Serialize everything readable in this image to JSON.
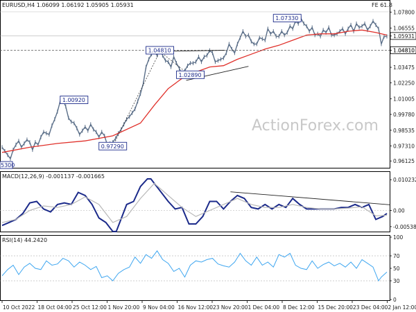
{
  "header": {
    "symbol_line": "EURUSD,H4  1.06099 1.06192 1.05905 1.05931",
    "fe_label": "FE 61.8",
    "watermark": "ActionForex.com"
  },
  "colors": {
    "candles": "#5a6e88",
    "ma": "#e0302a",
    "macd": "#1b2a8a",
    "signal": "#b8b8b8",
    "rsi": "#3ea6f0",
    "trend": "#222222",
    "label_border": "#1b2a8a",
    "grid_dash": "#555555"
  },
  "chart_data": [
    {
      "type": "line",
      "name": "price",
      "title": "EURUSD,H4  1.06099 1.06192 1.05905 1.05931",
      "ylim": [
        0.957,
        1.081
      ],
      "y_ticks": [
        "1.07800",
        "1.06555",
        "1.05931",
        "1.04810",
        "1.03475",
        "1.02250",
        "1.01005",
        "0.99780",
        "0.98535",
        "0.97310",
        "0.96125"
      ],
      "x_ticks": [
        "10 Oct 2022",
        "18 Oct 04:00",
        "25 Oct 12:00",
        "1 Nov 20:00",
        "9 Nov 04:00",
        "16 Nov 12:00",
        "23 Nov 20:00",
        "1 Dec 04:00",
        "8 Dec 12:00",
        "15 Dec 20:00",
        "23 Dec 04:00",
        "2 Jan 12:00"
      ],
      "current_price": "1.05931",
      "series": [
        {
          "name": "EURUSD",
          "x": [
            0,
            4,
            8,
            12,
            16,
            20,
            24,
            28,
            32,
            36,
            40,
            44,
            48,
            52,
            56,
            60,
            64,
            68,
            72,
            76,
            80,
            84,
            88,
            92,
            96,
            100,
            104,
            108,
            112,
            116,
            120,
            124,
            128,
            132,
            136,
            140,
            144,
            148,
            152,
            156,
            160,
            164,
            168,
            172,
            176,
            180,
            184,
            188,
            192,
            196,
            200,
            204,
            208,
            212,
            216,
            220,
            224,
            228,
            232,
            236,
            240,
            244,
            248,
            252,
            256,
            260,
            264,
            268,
            272,
            276,
            280,
            284,
            288,
            292,
            296,
            300,
            304,
            308,
            312,
            316,
            320,
            324,
            328,
            332,
            336,
            340,
            344,
            348,
            352,
            356,
            360,
            364,
            368,
            372,
            376,
            380,
            384,
            388,
            392,
            396,
            400,
            404,
            408,
            412,
            416,
            420,
            424,
            428,
            432,
            436,
            440,
            444,
            448,
            452,
            456,
            460,
            464,
            468,
            472,
            476,
            480,
            484,
            488,
            492,
            496,
            500,
            504,
            508,
            512,
            516,
            520,
            524,
            528,
            532,
            536,
            540,
            544,
            548,
            552,
            556
          ],
          "values": [
            0.972,
            0.969,
            0.966,
            0.963,
            0.97,
            0.974,
            0.977,
            0.972,
            0.975,
            0.978,
            0.976,
            0.97,
            0.976,
            0.974,
            0.98,
            0.984,
            0.983,
            0.982,
            0.989,
            0.994,
            1.0,
            1.008,
            1.009,
            1.004,
            0.995,
            0.992,
            0.991,
            0.987,
            0.982,
            0.985,
            0.988,
            0.985,
            0.99,
            0.986,
            0.984,
            0.98,
            0.984,
            0.981,
            0.974,
            0.975,
            0.976,
            0.979,
            0.983,
            0.986,
            0.99,
            0.994,
            0.996,
            0.999,
            1.002,
            1.008,
            1.014,
            1.022,
            1.035,
            1.041,
            1.045,
            1.047,
            1.044,
            1.049,
            1.044,
            1.04,
            1.039,
            1.035,
            1.043,
            1.038,
            1.034,
            1.029,
            1.032,
            1.036,
            1.038,
            1.038,
            1.039,
            1.043,
            1.039,
            1.043,
            1.044,
            1.048,
            1.046,
            1.039,
            1.04,
            1.041,
            1.042,
            1.046,
            1.053,
            1.049,
            1.046,
            1.053,
            1.058,
            1.063,
            1.059,
            1.06,
            1.055,
            1.053,
            1.053,
            1.058,
            1.057,
            1.056,
            1.065,
            1.061,
            1.063,
            1.059,
            1.059,
            1.063,
            1.06,
            1.062,
            1.067,
            1.065,
            1.071,
            1.069,
            1.073,
            1.069,
            1.067,
            1.063,
            1.066,
            1.06,
            1.061,
            1.059,
            1.064,
            1.062,
            1.066,
            1.06,
            1.06,
            1.061,
            1.063,
            1.065,
            1.061,
            1.065,
            1.068,
            1.063,
            1.069,
            1.066,
            1.067,
            1.069,
            1.064,
            1.067,
            1.071,
            1.068,
            1.065,
            1.053,
            1.059,
            1.059
          ]
        },
        {
          "name": "MA",
          "x": [
            0,
            40,
            80,
            120,
            160,
            200,
            220,
            240,
            260,
            280,
            300,
            320,
            340,
            360,
            380,
            400,
            420,
            440,
            460,
            480,
            500,
            520,
            540,
            556
          ],
          "values": [
            0.968,
            0.972,
            0.975,
            0.977,
            0.981,
            0.991,
            1.005,
            1.018,
            1.026,
            1.031,
            1.035,
            1.036,
            1.041,
            1.045,
            1.049,
            1.052,
            1.056,
            1.06,
            1.061,
            1.061,
            1.063,
            1.064,
            1.062,
            1.06
          ]
        }
      ],
      "annotations": [
        {
          "text": "1.00920",
          "x": 104,
          "y": 1.0092
        },
        {
          "text": "0.97290",
          "x": 160,
          "y": 0.9729
        },
        {
          "text": "1.04810",
          "x": 228,
          "y": 1.0481
        },
        {
          "text": "1.02890",
          "x": 272,
          "y": 1.0289
        },
        {
          "text": "1.07330",
          "x": 412,
          "y": 1.0733
        },
        {
          "text": "1.04810",
          "axis": true,
          "y": 1.0481
        }
      ]
    },
    {
      "type": "line",
      "name": "macd",
      "title": "MACD(12,26,9) -0.001137 -0.001665",
      "ylim": [
        -0.0068,
        0.0112
      ],
      "y_ticks": [
        "0.010232",
        "0.00",
        "-0.005389"
      ],
      "series": [
        {
          "name": "MACD",
          "x": [
            0,
            10,
            20,
            30,
            40,
            50,
            60,
            70,
            80,
            90,
            100,
            110,
            120,
            130,
            140,
            150,
            160,
            165,
            170,
            180,
            190,
            200,
            210,
            215,
            220,
            230,
            240,
            250,
            260,
            270,
            280,
            290,
            300,
            310,
            320,
            330,
            340,
            350,
            360,
            370,
            380,
            390,
            400,
            410,
            420,
            430,
            440,
            450,
            460,
            470,
            480,
            490,
            500,
            510,
            520,
            530,
            540,
            550,
            556
          ],
          "values": [
            -0.005,
            -0.004,
            -0.003,
            -0.001,
            0.0025,
            0.003,
            0.0005,
            -0.0005,
            0.002,
            0.0025,
            0.002,
            0.006,
            0.005,
            0.002,
            -0.0025,
            -0.004,
            -0.007,
            -0.007,
            -0.004,
            0.002,
            0.003,
            0.008,
            0.0105,
            0.0105,
            0.009,
            0.006,
            0.003,
            0.0005,
            0.001,
            -0.0045,
            -0.0045,
            -0.002,
            0.003,
            0.003,
            0.0005,
            0.003,
            0.005,
            0.004,
            0.001,
            0.0005,
            0.002,
            0.0005,
            0.002,
            0.001,
            0.004,
            0.002,
            0.0005,
            0.0005,
            0.0005,
            0.0005,
            0.0005,
            0.001,
            0.001,
            0.002,
            0.001,
            0.002,
            -0.003,
            -0.002,
            -0.001
          ]
        },
        {
          "name": "Signal",
          "x": [
            0,
            20,
            40,
            60,
            80,
            100,
            120,
            140,
            160,
            180,
            200,
            220,
            240,
            260,
            280,
            300,
            320,
            340,
            360,
            380,
            400,
            420,
            440,
            460,
            480,
            500,
            520,
            540,
            556
          ],
          "values": [
            -0.004,
            -0.003,
            0.0,
            0.0015,
            0.001,
            0.002,
            0.0045,
            0.002,
            -0.004,
            -0.002,
            0.004,
            0.009,
            0.005,
            0.001,
            -0.002,
            0.0,
            0.002,
            0.004,
            0.002,
            0.001,
            0.001,
            0.002,
            0.001,
            0.0005,
            0.0005,
            0.0008,
            0.0012,
            -0.0018,
            -0.0016
          ]
        }
      ],
      "trendline": {
        "x": [
          330,
          560
        ],
        "values": [
          0.0062,
          0.0019
        ]
      }
    },
    {
      "type": "line",
      "name": "rsi",
      "title": "RSI(14) 44.2420",
      "ylim": [
        0,
        100
      ],
      "y_ticks": [
        "100",
        "70",
        "50",
        "30",
        "0"
      ],
      "series": [
        {
          "name": "RSI",
          "x": [
            0,
            8,
            16,
            24,
            32,
            40,
            48,
            56,
            64,
            72,
            80,
            88,
            96,
            104,
            112,
            120,
            128,
            136,
            144,
            152,
            160,
            168,
            176,
            184,
            192,
            200,
            208,
            216,
            224,
            232,
            240,
            248,
            256,
            264,
            272,
            280,
            288,
            296,
            304,
            312,
            320,
            328,
            336,
            344,
            352,
            360,
            368,
            376,
            384,
            392,
            400,
            408,
            416,
            424,
            432,
            440,
            448,
            456,
            464,
            472,
            480,
            488,
            496,
            504,
            512,
            520,
            528,
            536,
            544,
            548,
            556
          ],
          "values": [
            38,
            48,
            55,
            40,
            52,
            58,
            50,
            48,
            62,
            55,
            57,
            66,
            62,
            52,
            60,
            55,
            48,
            53,
            35,
            38,
            30,
            42,
            48,
            52,
            68,
            58,
            72,
            66,
            78,
            64,
            58,
            45,
            50,
            36,
            55,
            62,
            60,
            64,
            66,
            57,
            54,
            52,
            60,
            74,
            62,
            55,
            68,
            55,
            60,
            52,
            72,
            68,
            74,
            55,
            50,
            48,
            62,
            50,
            56,
            60,
            54,
            58,
            52,
            60,
            50,
            64,
            58,
            52,
            30,
            36,
            44
          ]
        }
      ]
    }
  ]
}
